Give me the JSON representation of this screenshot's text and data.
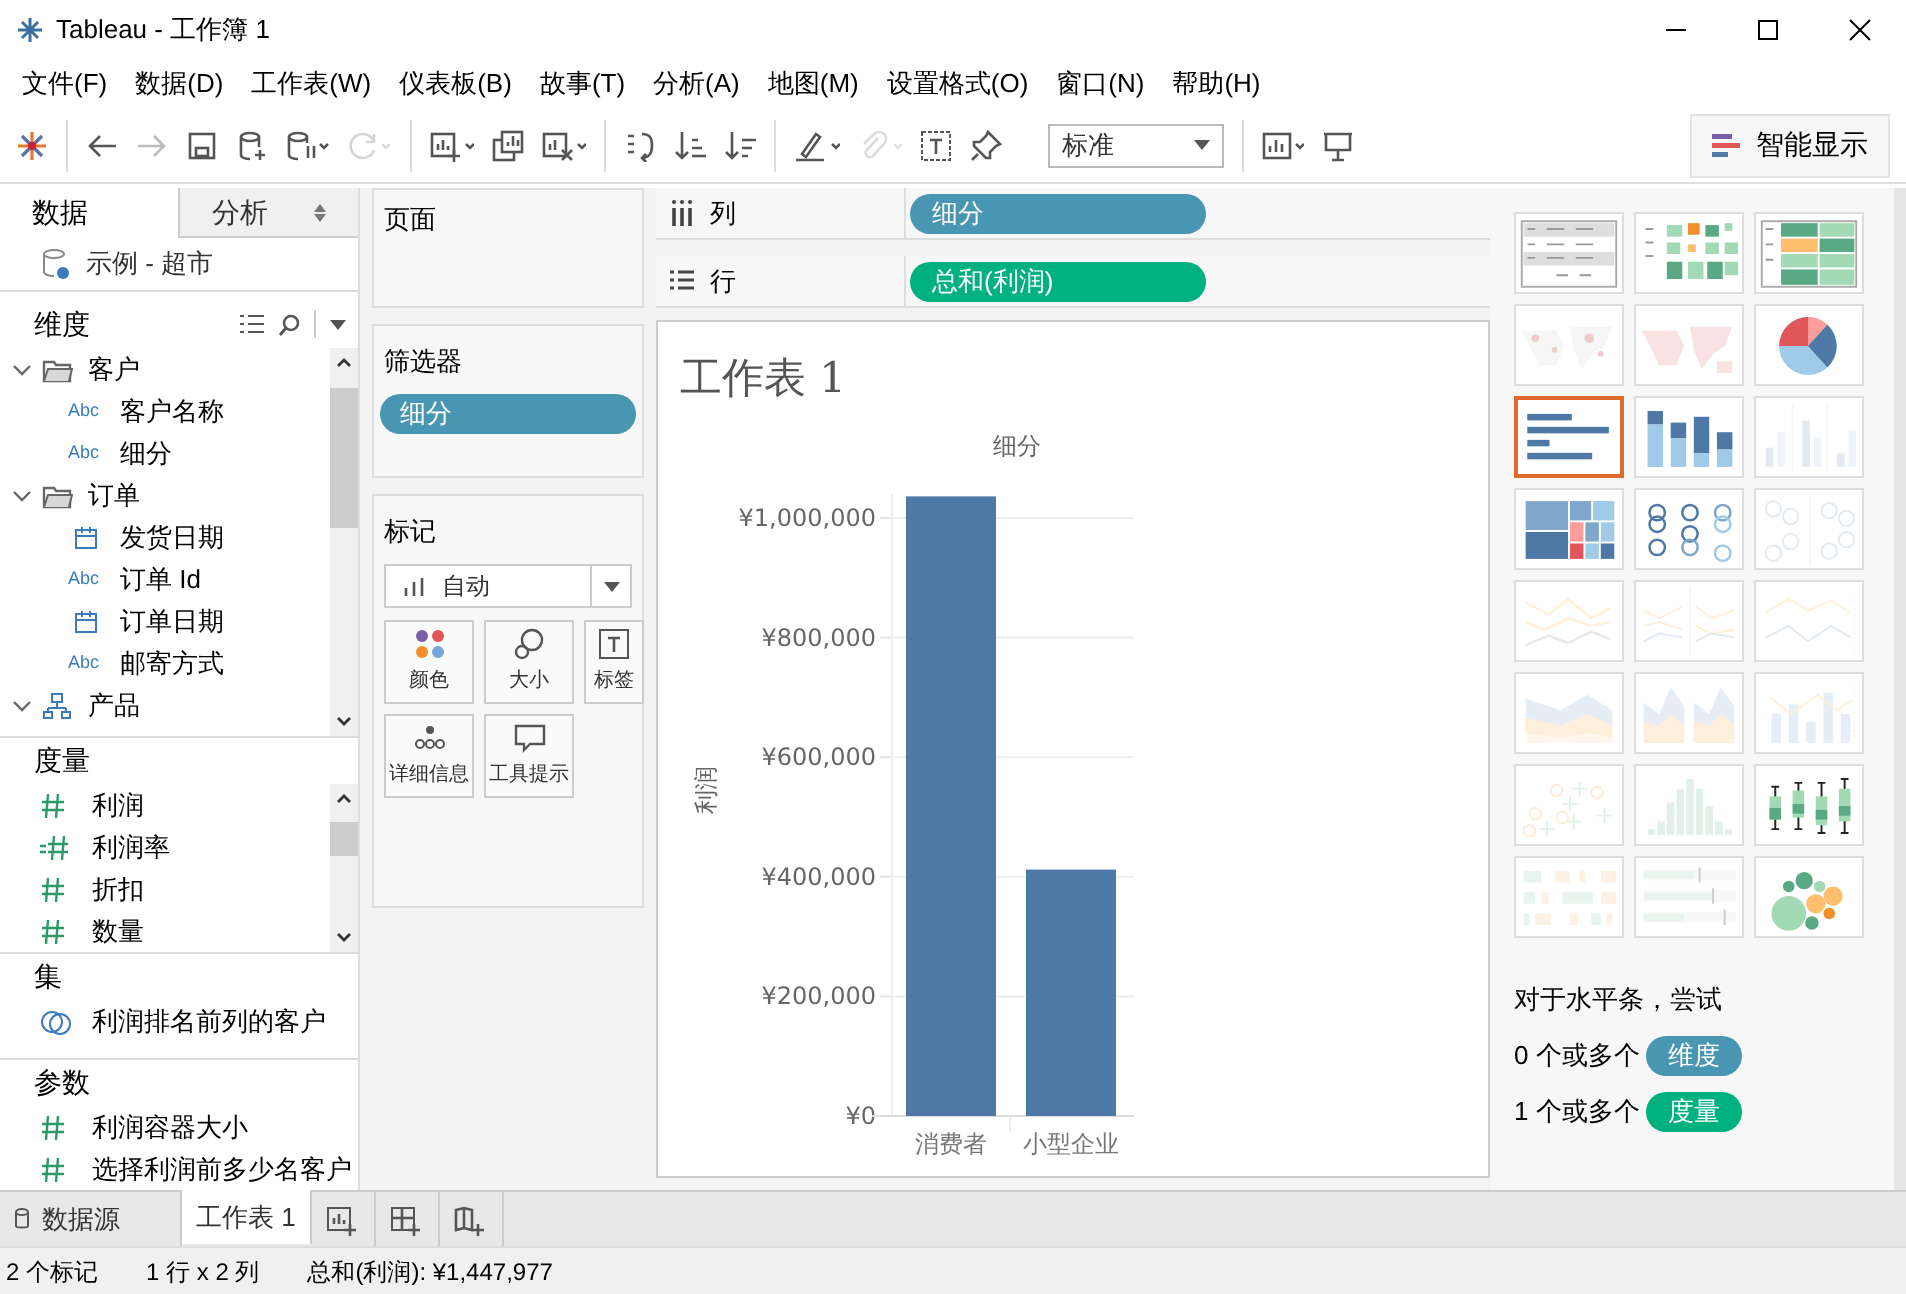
{
  "window": {
    "title": "Tableau - 工作簿 1"
  },
  "menu": [
    "文件(F)",
    "数据(D)",
    "工作表(W)",
    "仪表板(B)",
    "故事(T)",
    "分析(A)",
    "地图(M)",
    "设置格式(O)",
    "窗口(N)",
    "帮助(H)"
  ],
  "toolbar": [
    {
      "kind": "logo",
      "disabled": false
    },
    {
      "kind": "back",
      "disabled": false
    },
    {
      "kind": "forward",
      "disabled": true
    },
    {
      "kind": "save",
      "disabled": false
    },
    {
      "kind": "new-source",
      "disabled": false
    },
    {
      "kind": "pause",
      "disabled": false
    },
    {
      "kind": "refresh",
      "disabled": true
    },
    {
      "kind": "new-sheet",
      "disabled": false
    },
    {
      "kind": "duplicate",
      "disabled": false
    },
    {
      "kind": "clear",
      "disabled": false
    },
    {
      "kind": "swap",
      "disabled": false
    },
    {
      "kind": "sort-asc",
      "disabled": false
    },
    {
      "kind": "sort-desc",
      "disabled": false
    },
    {
      "kind": "highlight",
      "disabled": false
    },
    {
      "kind": "clip",
      "disabled": true
    },
    {
      "kind": "label",
      "disabled": false
    },
    {
      "kind": "pin",
      "disabled": false
    },
    {
      "kind": "fit",
      "value": "标准"
    },
    {
      "kind": "cards",
      "disabled": false
    },
    {
      "kind": "present",
      "disabled": false
    }
  ],
  "show_me_button": "智能显示",
  "data_pane": {
    "tabs": [
      {
        "label": "数据",
        "selected": true
      },
      {
        "label": "分析",
        "selected": false
      }
    ],
    "source": "示例 - 超市",
    "dimensions": {
      "title": "维度",
      "items": [
        {
          "kind": "folder",
          "label": "客户",
          "expanded": true,
          "children": [
            {
              "kind": "text",
              "type_icon": "Abc",
              "label": "客户名称"
            },
            {
              "kind": "text",
              "type_icon": "Abc",
              "label": "细分"
            }
          ]
        },
        {
          "kind": "folder",
          "label": "订单",
          "expanded": true,
          "children": [
            {
              "kind": "date",
              "label": "发货日期"
            },
            {
              "kind": "text",
              "type_icon": "Abc",
              "label": "订单 Id"
            },
            {
              "kind": "date",
              "label": "订单日期"
            },
            {
              "kind": "text",
              "type_icon": "Abc",
              "label": "邮寄方式"
            }
          ]
        },
        {
          "kind": "hierarchy",
          "label": "产品",
          "expanded": true
        }
      ]
    },
    "measures": {
      "title": "度量",
      "items": [
        {
          "kind": "number",
          "label": "利润"
        },
        {
          "kind": "calc",
          "label": "利润率"
        },
        {
          "kind": "number",
          "label": "折扣"
        },
        {
          "kind": "number",
          "label": "数量"
        }
      ]
    },
    "sets": {
      "title": "集",
      "items": [
        {
          "kind": "set",
          "label": "利润排名前列的客户"
        }
      ]
    },
    "parameters": {
      "title": "参数",
      "items": [
        {
          "kind": "number",
          "label": "利润容器大小"
        },
        {
          "kind": "number",
          "label": "选择利润前多少名客户"
        }
      ]
    }
  },
  "pages_card": {
    "title": "页面"
  },
  "filters_card": {
    "title": "筛选器",
    "pills": [
      {
        "label": "细分",
        "color": "#4996b2"
      }
    ]
  },
  "marks_card": {
    "title": "标记",
    "mark_type": "自动",
    "buttons": [
      {
        "kind": "color",
        "label": "颜色"
      },
      {
        "kind": "size",
        "label": "大小"
      },
      {
        "kind": "label",
        "label": "标签"
      },
      {
        "kind": "detail",
        "label": "详细信息"
      },
      {
        "kind": "tooltip",
        "label": "工具提示"
      }
    ]
  },
  "shelves": [
    {
      "kind": "columns",
      "label": "列",
      "pills": [
        {
          "label": "细分",
          "color": "#4996b2"
        }
      ]
    },
    {
      "kind": "rows",
      "label": "行",
      "pills": [
        {
          "label": "总和(利润)",
          "color": "#00b180"
        }
      ]
    }
  ],
  "worksheet": {
    "chart_data": {
      "type": "bar",
      "title": "工作表 1",
      "xlabel": "细分",
      "ylabel": "利润",
      "categories": [
        "消费者",
        "小型企业"
      ],
      "values": [
        1036000,
        412000
      ],
      "grid": true,
      "ylim": [
        0,
        1040000
      ],
      "yticks": [
        {
          "value": 0,
          "label": "¥0"
        },
        {
          "value": 200000,
          "label": "¥200,000"
        },
        {
          "value": 400000,
          "label": "¥400,000"
        },
        {
          "value": 600000,
          "label": "¥600,000"
        },
        {
          "value": 800000,
          "label": "¥800,000"
        },
        {
          "value": 1000000,
          "label": "¥1,000,000"
        }
      ]
    }
  },
  "show_me": {
    "charts": [
      {
        "kind": "text-table",
        "available": true,
        "selected": false
      },
      {
        "kind": "heat-map",
        "available": true,
        "selected": false
      },
      {
        "kind": "highlight-table",
        "available": true,
        "selected": false
      },
      {
        "kind": "symbol-map",
        "available": false,
        "selected": false
      },
      {
        "kind": "filled-map",
        "available": false,
        "selected": false
      },
      {
        "kind": "pie",
        "available": true,
        "selected": false
      },
      {
        "kind": "hbar",
        "available": true,
        "selected": true
      },
      {
        "kind": "stacked-bar",
        "available": true,
        "selected": false
      },
      {
        "kind": "side-bar",
        "available": false,
        "selected": false
      },
      {
        "kind": "treemap",
        "available": true,
        "selected": false
      },
      {
        "kind": "circles",
        "available": true,
        "selected": false
      },
      {
        "kind": "side-circles",
        "available": false,
        "selected": false
      },
      {
        "kind": "line",
        "available": false,
        "selected": false
      },
      {
        "kind": "line-split",
        "available": false,
        "selected": false
      },
      {
        "kind": "dual-line",
        "available": false,
        "selected": false
      },
      {
        "kind": "area",
        "available": false,
        "selected": false
      },
      {
        "kind": "area-split",
        "available": false,
        "selected": false
      },
      {
        "kind": "combo",
        "available": false,
        "selected": false
      },
      {
        "kind": "scatter",
        "available": false,
        "selected": false
      },
      {
        "kind": "histogram",
        "available": false,
        "selected": false
      },
      {
        "kind": "box-plot",
        "available": true,
        "selected": false
      },
      {
        "kind": "gantt",
        "available": false,
        "selected": false
      },
      {
        "kind": "bullet",
        "available": false,
        "selected": false
      },
      {
        "kind": "bubbles",
        "available": true,
        "selected": false
      }
    ],
    "hint": "对于水平条，尝试",
    "requirements": [
      {
        "count": "0 个或多个",
        "pill": "维度",
        "color": "#4996b2"
      },
      {
        "count": "1 个或多个",
        "pill": "度量",
        "color": "#00b180"
      }
    ]
  },
  "sheet_tabs": [
    {
      "kind": "data-source",
      "label": "数据源",
      "selected": false
    },
    {
      "kind": "sheet",
      "label": "工作表 1",
      "selected": true
    },
    {
      "kind": "new-sheet"
    },
    {
      "kind": "new-dashboard"
    },
    {
      "kind": "new-story"
    }
  ],
  "status_bar": [
    "2 个标记",
    "1 行 x 2 列",
    "总和(利润): ¥1,447,977"
  ]
}
